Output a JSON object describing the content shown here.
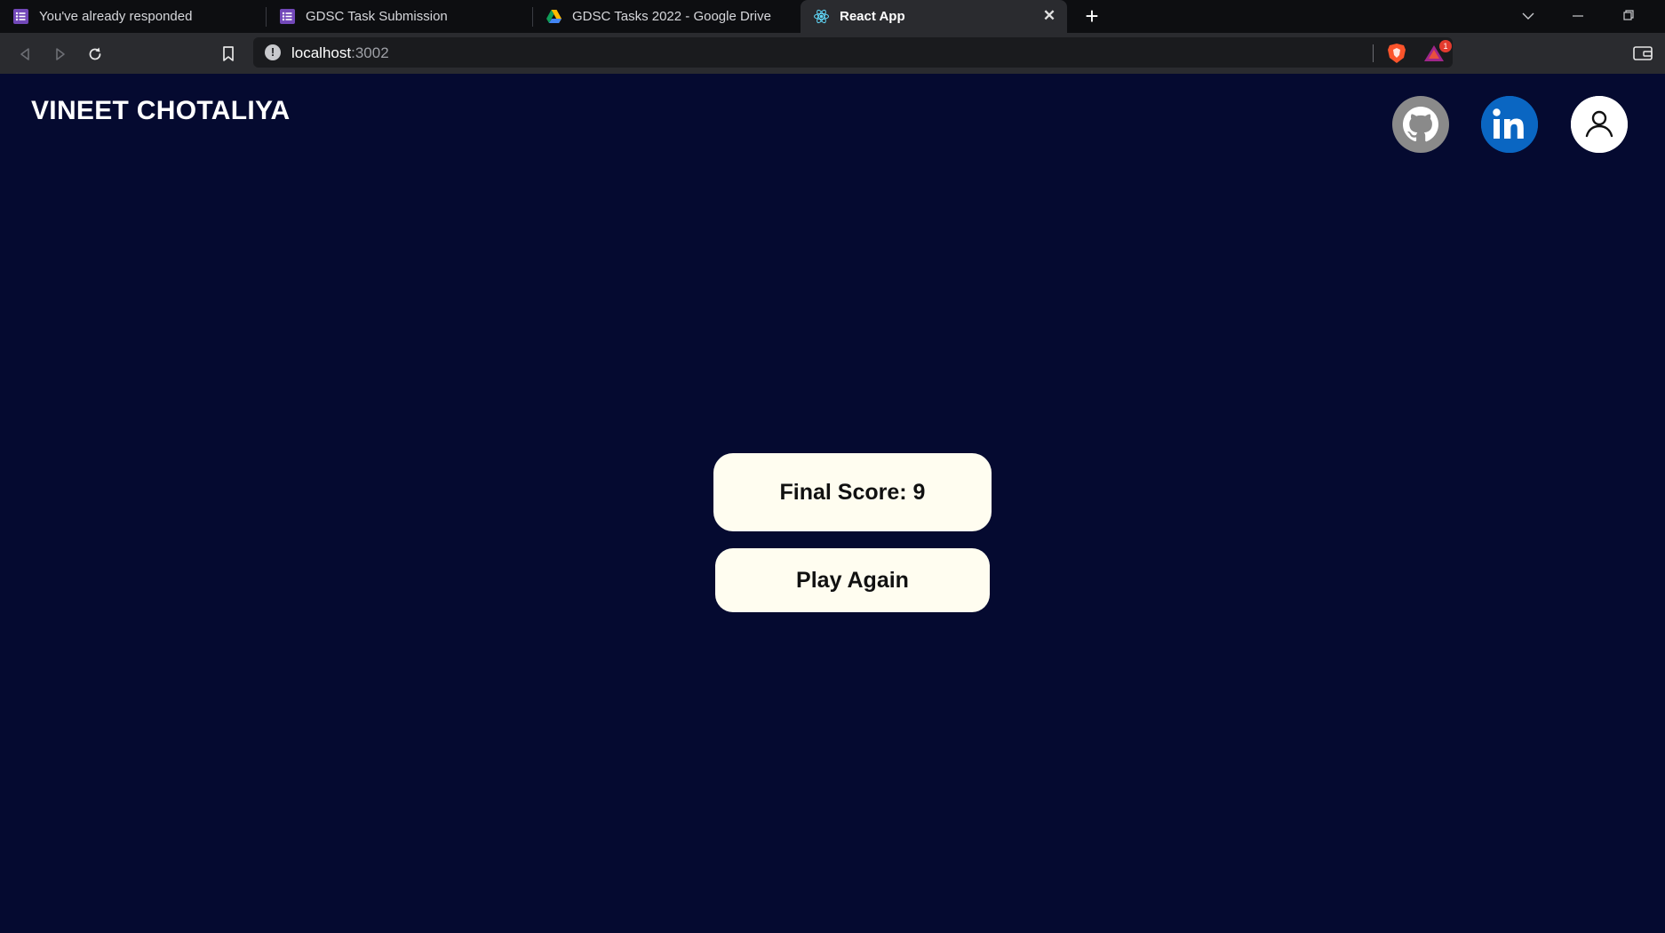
{
  "browser": {
    "tabs": [
      {
        "title": "You've already responded",
        "icon": "google-forms-icon",
        "active": false
      },
      {
        "title": "GDSC Task Submission",
        "icon": "google-forms-icon",
        "active": false
      },
      {
        "title": "GDSC Tasks 2022 - Google Drive",
        "icon": "google-drive-icon",
        "active": false
      },
      {
        "title": "React App",
        "icon": "react-icon",
        "active": true
      }
    ],
    "new_tab_label": "+",
    "close_tab_label": "✕",
    "address": {
      "host": "localhost",
      "port": ":3002"
    },
    "rewards_badge": "1",
    "colors": {
      "tabstrip": "#0d0e11",
      "toolbar": "#2a2b2f",
      "omnibox": "#1a1b1e"
    }
  },
  "page": {
    "brand": "VINEET CHOTALIYA",
    "social": [
      {
        "name": "github-icon"
      },
      {
        "name": "linkedin-icon"
      },
      {
        "name": "profile-icon"
      }
    ],
    "score_label": "Final Score: 9",
    "play_again_label": "Play Again",
    "colors": {
      "background": "#050a30",
      "card": "#fffdf0",
      "linkedin": "#0a66c2",
      "github": "#8a8a8a"
    }
  }
}
